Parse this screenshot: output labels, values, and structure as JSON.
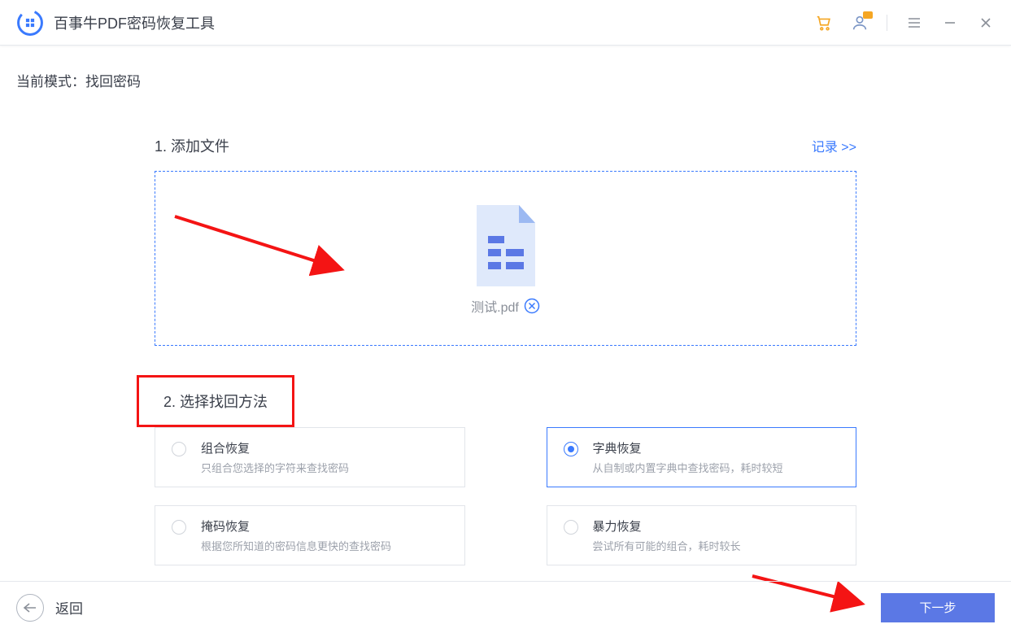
{
  "app": {
    "title": "百事牛PDF密码恢复工具"
  },
  "header": {
    "mode_label": "当前模式：",
    "mode_value": "找回密码"
  },
  "step1": {
    "title": "1. 添加文件",
    "records_link": "记录 >>",
    "file_name": "测试.pdf"
  },
  "step2": {
    "title": "2. 选择找回方法",
    "methods": [
      {
        "title": "组合恢复",
        "desc": "只组合您选择的字符来查找密码",
        "selected": false
      },
      {
        "title": "字典恢复",
        "desc": "从自制或内置字典中查找密码，耗时较短",
        "selected": true
      },
      {
        "title": "掩码恢复",
        "desc": "根据您所知道的密码信息更快的查找密码",
        "selected": false
      },
      {
        "title": "暴力恢复",
        "desc": "尝试所有可能的组合，耗时较长",
        "selected": false
      }
    ]
  },
  "footer": {
    "back_label": "返回",
    "next_label": "下一步"
  },
  "colors": {
    "primary": "#3a7afe",
    "annotation": "#f41414"
  }
}
